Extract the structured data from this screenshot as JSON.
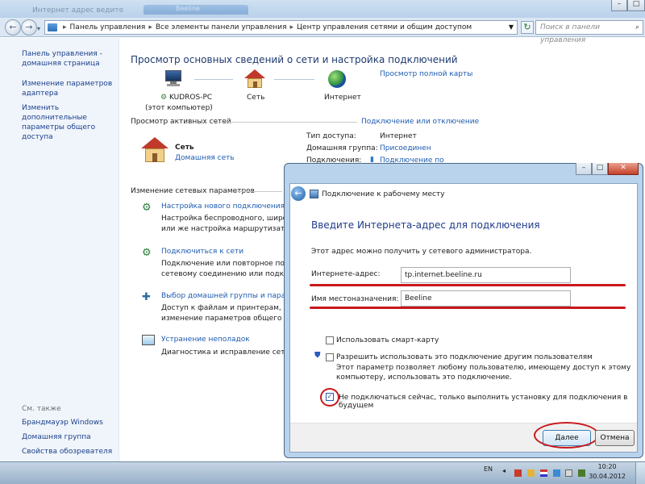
{
  "titlebar": {
    "ghost_left": "Интернет  адрес   ведите",
    "ghost_tab": "Beeline"
  },
  "navbar": {
    "address": [
      "Панель управления",
      "Все элементы панели управления",
      "Центр управления сетями и общим доступом"
    ],
    "search_placeholder": "Поиск в панели управления"
  },
  "sidebar": {
    "items": [
      {
        "label": "Панель управления - домашняя страница"
      },
      {
        "label": "Изменение параметров адаптера"
      },
      {
        "label": "Изменить дополнительные параметры общего доступа"
      }
    ],
    "see_also": "См. также",
    "see_also_items": [
      "Брандмауэр Windows",
      "Домашняя группа",
      "Свойства обозревателя"
    ]
  },
  "content": {
    "heading": "Просмотр основных сведений о сети и настройка подключений",
    "full_map_link": "Просмотр полной карты",
    "map": {
      "computer_name": "KUDROS-PC",
      "computer_note": "(этот компьютер)",
      "network": "Сеть",
      "internet": "Интернет"
    },
    "active_networks_label": "Просмотр активных сетей",
    "connect_disconnect_link": "Подключение или отключение",
    "network_name": "Сеть",
    "network_type": "Домашняя сеть",
    "access": {
      "access_type_label": "Тип доступа:",
      "access_type_value": "Интернет",
      "home_group_label": "Домашняя группа:",
      "home_group_value": "Присоединен",
      "connections_label": "Подключения:",
      "connections_value": "Подключение по"
    },
    "change_settings_label": "Изменение сетевых параметров",
    "tasks": [
      {
        "title": "Настройка нового подключения или се",
        "desc1": "Настройка беспроводного, широкопол",
        "desc2": "или же настройка маршрутизатора или"
      },
      {
        "title": "Подключиться к сети",
        "desc1": "Подключение или повторное подключе",
        "desc2": "сетевому соединению или подключени"
      },
      {
        "title": "Выбор домашней группы и параметро",
        "desc1": "Доступ к файлам и принтерам, располо",
        "desc2": "изменение параметров общего доступ"
      },
      {
        "title": "Устранение неполадок",
        "desc1": "Диагностика и исправление сетевых пр",
        "desc2": ""
      }
    ]
  },
  "dialog": {
    "title": "Подключение к рабочему месту",
    "heading": "Введите Интернета-адрес для подключения",
    "hint": "Этот адрес можно получить у сетевого администратора.",
    "address_label": "Интернете-адрес:",
    "address_value": "tp.internet.beeline.ru",
    "dest_label": "Имя местоназначения:",
    "dest_value": "Beeline",
    "smartcard_label": "Использовать смарт-карту",
    "smartcard_checked": false,
    "allow_others_label": "Разрешить использовать это подключение другим пользователям",
    "allow_others_desc1": "Этот параметр позволяет любому пользователю, имеющему доступ к этому",
    "allow_others_desc2": "компьютеру, использовать это подключение.",
    "allow_others_checked": false,
    "dont_connect_label": "Не подключаться сейчас, только выполнить установку для подключения в будущем",
    "dont_connect_checked": true,
    "next_button": "Далее",
    "cancel_button": "Отмена",
    "annotation_color": "#c8181c"
  },
  "taskbar": {
    "lang": "EN",
    "time": "10:20",
    "date": "30.04.2012"
  }
}
